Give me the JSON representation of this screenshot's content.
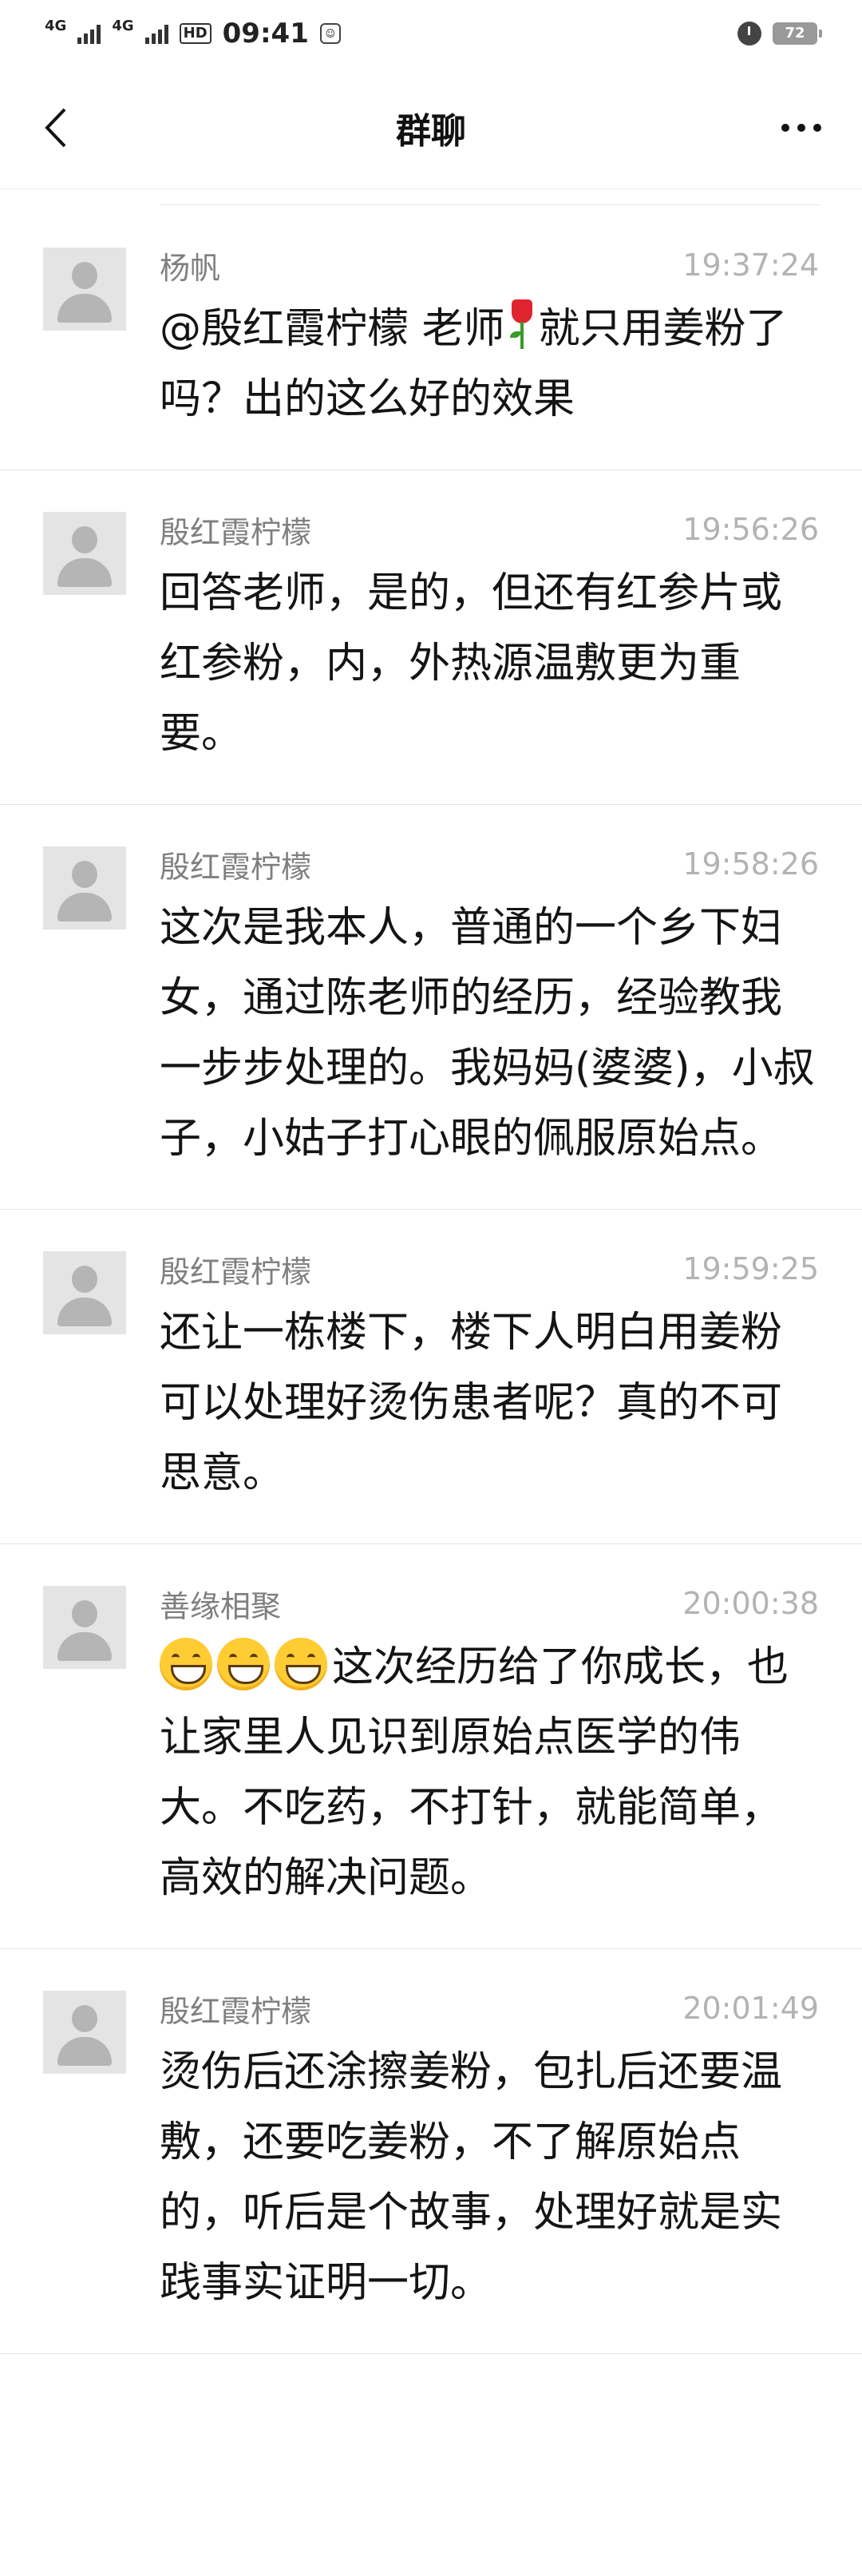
{
  "status_bar": {
    "net1": "4G",
    "net2": "4G",
    "hd": "HD",
    "time": "09:41",
    "battery": "72"
  },
  "nav": {
    "title": "群聊"
  },
  "messages": [
    {
      "sender": "杨帆",
      "time": "19:37:24",
      "text_a": "@殷红霞柠檬 老师",
      "emoji": "rose",
      "text_b": "就只用姜粉了吗？出的这么好的效果"
    },
    {
      "sender": "殷红霞柠檬",
      "time": "19:56:26",
      "text": "回答老师，是的，但还有红参片或红参粉，内，外热源温敷更为重要。"
    },
    {
      "sender": "殷红霞柠檬",
      "time": "19:58:26",
      "text": "这次是我本人，普通的一个乡下妇女，通过陈老师的经历，经验教我一步步处理的。我妈妈(婆婆)，小叔子，小姑子打心眼的佩服原始点。"
    },
    {
      "sender": "殷红霞柠檬",
      "time": "19:59:25",
      "text": "还让一栋楼下，楼下人明白用姜粉可以处理好烫伤患者呢？真的不可思意。"
    },
    {
      "sender": "善缘相聚",
      "time": "20:00:38",
      "emoji": "grinning-face",
      "emoji_count": 3,
      "text": "这次经历给了你成长，也让家里人见识到原始点医学的伟大。不吃药，不打针，就能简单，高效的解决问题。"
    },
    {
      "sender": "殷红霞柠檬",
      "time": "20:01:49",
      "text": "烫伤后还涂擦姜粉，包扎后还要温敷，还要吃姜粉，不了解原始点的，听后是个故事，处理好就是实践事实证明一切。"
    }
  ]
}
